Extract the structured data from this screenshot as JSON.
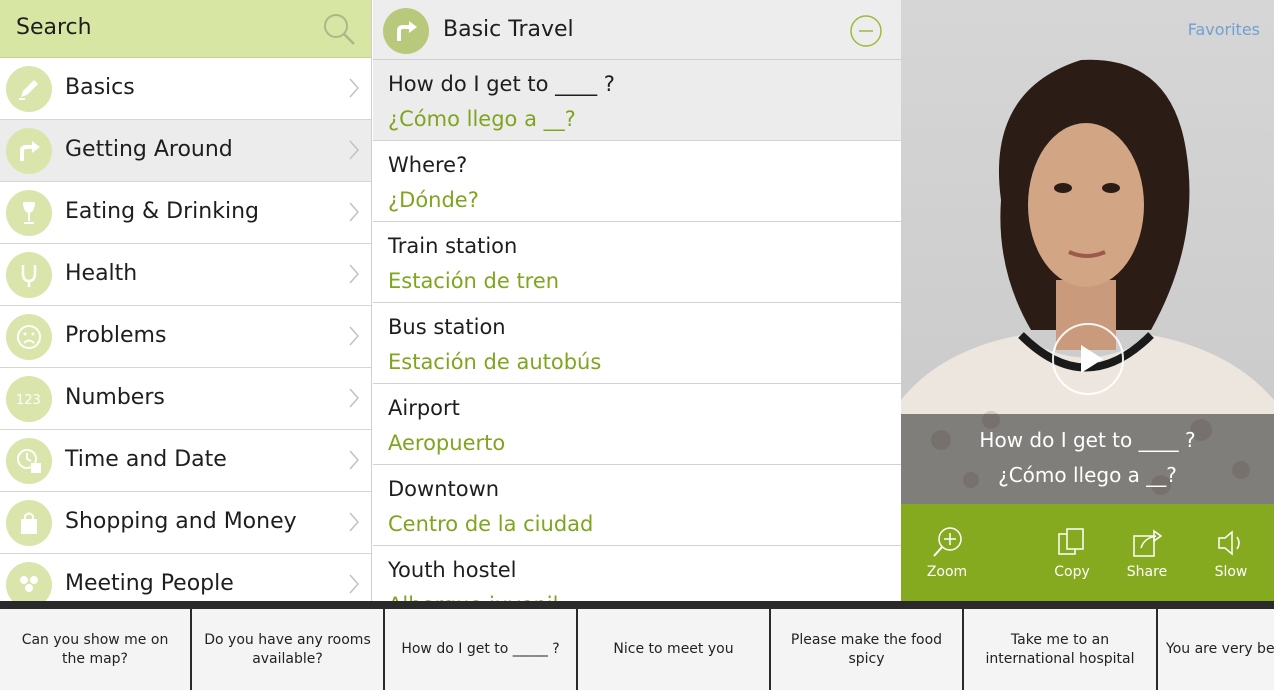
{
  "search": {
    "label": "Search"
  },
  "categories": [
    {
      "label": "Basics",
      "icon": "pen-icon"
    },
    {
      "label": "Getting Around",
      "icon": "turn-arrow-icon",
      "selected": true
    },
    {
      "label": "Eating & Drinking",
      "icon": "wine-glass-icon"
    },
    {
      "label": "Health",
      "icon": "stethoscope-icon"
    },
    {
      "label": "Problems",
      "icon": "sad-face-icon"
    },
    {
      "label": "Numbers",
      "icon": "numbers-icon"
    },
    {
      "label": "Time and Date",
      "icon": "clock-calendar-icon"
    },
    {
      "label": "Shopping and Money",
      "icon": "shopping-bag-icon"
    },
    {
      "label": "Meeting People",
      "icon": "people-icon"
    }
  ],
  "section": {
    "title": "Basic Travel"
  },
  "phrases": [
    {
      "en": "How do I get to ____ ?",
      "es": "¿Cómo llego a __?",
      "selected": true
    },
    {
      "en": "Where?",
      "es": "¿Dónde?"
    },
    {
      "en": "Train station",
      "es": "Estación de tren"
    },
    {
      "en": "Bus station",
      "es": "Estación de autobús"
    },
    {
      "en": "Airport",
      "es": "Aeropuerto"
    },
    {
      "en": "Downtown",
      "es": "Centro de la ciudad"
    },
    {
      "en": "Youth hostel",
      "es": "Albergue juvenil"
    }
  ],
  "video": {
    "favorites_label": "Favorites",
    "caption_en": "How do I get to ____ ?",
    "caption_es": "¿Cómo llego a __?"
  },
  "toolbar": {
    "zoom": "Zoom",
    "copy": "Copy",
    "share": "Share",
    "slow": "Slow"
  },
  "quick_phrases": [
    "Can you show me on the map?",
    "Do you have any rooms available?",
    "How do I get to _____ ?",
    "Nice to meet you",
    "Please make the food spicy",
    "Take me to an international hospital",
    "You are very beautiful"
  ],
  "colors": {
    "accent_green": "#86aa1f",
    "spanish_text": "#7fa51f",
    "search_bg": "#d8e6a4",
    "favorites_link": "#6fa0d4"
  }
}
